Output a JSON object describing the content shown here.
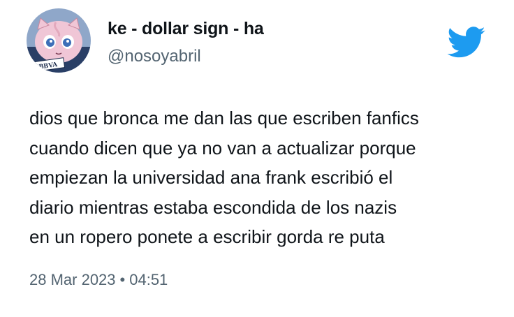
{
  "author": {
    "display_name": "ke - dollar sign - ha",
    "handle": "@nosoyabril",
    "avatar_badge_text": "BBVA"
  },
  "tweet": {
    "lines": [
      "dios que bronca me dan las que escriben fanfics",
      "cuando dicen que ya no van a actualizar porque",
      "empiezan la universidad ana frank escribió el",
      "diario mientras estaba escondida de los nazis",
      "en un ropero ponete a escribir gorda re puta"
    ]
  },
  "meta": {
    "date": "28 Mar 2023",
    "separator": "•",
    "time": "04:51"
  },
  "icons": {
    "brand": "twitter-bird-icon"
  },
  "colors": {
    "brand_blue": "#1d9bf0",
    "text_primary": "#0f1419",
    "text_secondary": "#536471",
    "avatar_bg": "#8fa7c9",
    "avatar_character": "#f0c6d6"
  }
}
